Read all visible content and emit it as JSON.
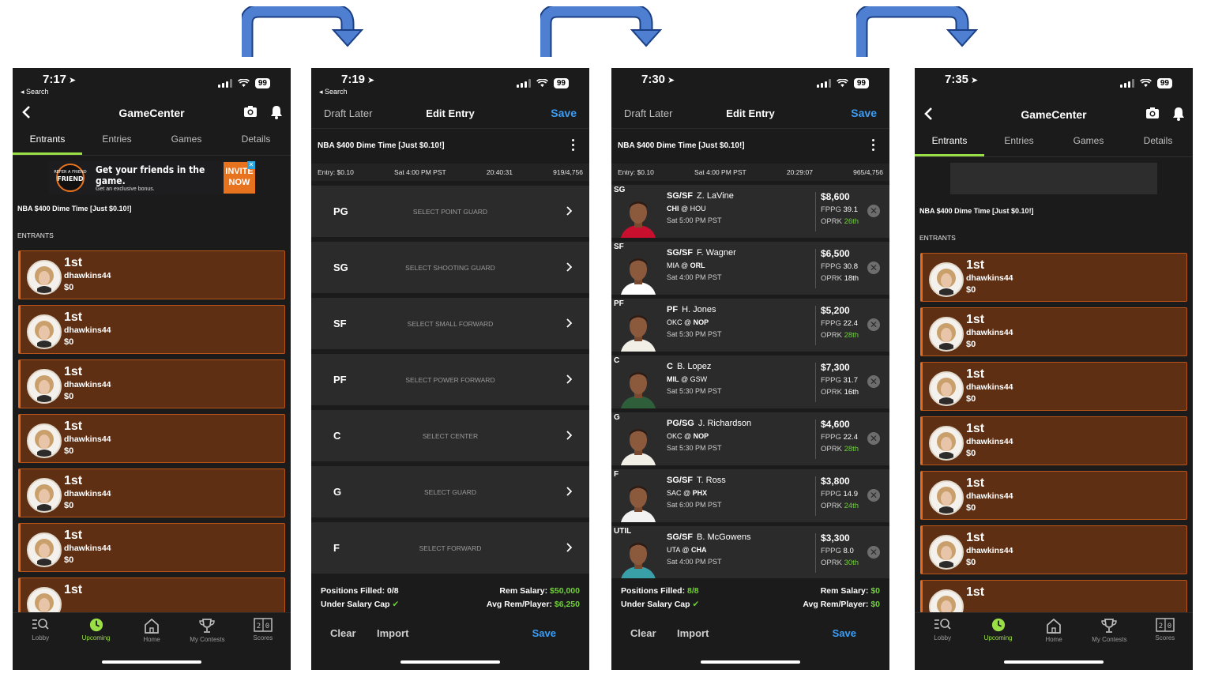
{
  "colors": {
    "arrow": "#2f5aa8",
    "accent_green": "#9adf46",
    "entrant_bg": "#5e2f13",
    "entrant_border": "#e66b1f",
    "save_blue": "#3b9df5",
    "value_green": "#6fcf3a"
  },
  "screen1": {
    "status": {
      "time": "7:17",
      "back": "◂ Search",
      "battery": "99"
    },
    "title": "GameCenter",
    "tabs": [
      "Entrants",
      "Entries",
      "Games",
      "Details"
    ],
    "banner": {
      "text_big": "Get your friends in the game.",
      "text_small": "Get an exclusive bonus.",
      "badge": "REFER A FRIEND",
      "invite_1": "INVITE",
      "invite_2": "NOW"
    },
    "contest": "NBA $400 Dime Time [Just $0.10!]",
    "section_label": "ENTRANTS",
    "entrants": [
      {
        "rank": "1st",
        "user": "dhawkins44",
        "amount": "$0"
      },
      {
        "rank": "1st",
        "user": "dhawkins44",
        "amount": "$0"
      },
      {
        "rank": "1st",
        "user": "dhawkins44",
        "amount": "$0"
      },
      {
        "rank": "1st",
        "user": "dhawkins44",
        "amount": "$0"
      },
      {
        "rank": "1st",
        "user": "dhawkins44",
        "amount": "$0"
      },
      {
        "rank": "1st",
        "user": "dhawkins44",
        "amount": "$0"
      },
      {
        "rank": "1st",
        "user": "",
        "amount": ""
      }
    ],
    "nav": [
      "Lobby",
      "Upcoming",
      "Home",
      "My Contests",
      "Scores"
    ]
  },
  "screen2": {
    "status": {
      "time": "7:19",
      "back": "◂ Search",
      "battery": "99"
    },
    "left": "Draft Later",
    "title": "Edit Entry",
    "save": "Save",
    "contest": "NBA $400 Dime Time [Just $0.10!]",
    "info": {
      "entry": "Entry: $0.10",
      "start": "Sat 4:00 PM PST",
      "countdown": "20:40:31",
      "count": "919/4,756"
    },
    "slots": [
      {
        "pos": "PG",
        "hint": "SELECT POINT GUARD"
      },
      {
        "pos": "SG",
        "hint": "SELECT SHOOTING GUARD"
      },
      {
        "pos": "SF",
        "hint": "SELECT SMALL FORWARD"
      },
      {
        "pos": "PF",
        "hint": "SELECT POWER FORWARD"
      },
      {
        "pos": "C",
        "hint": "SELECT CENTER"
      },
      {
        "pos": "G",
        "hint": "SELECT GUARD"
      },
      {
        "pos": "F",
        "hint": "SELECT FORWARD"
      }
    ],
    "footer": {
      "positions_label": "Positions Filled:",
      "positions_value": "0/8",
      "cap_label": "Under Salary Cap",
      "rem_label": "Rem Salary:",
      "rem_value": "$50,000",
      "avg_label": "Avg Rem/Player:",
      "avg_value": "$6,250",
      "clear": "Clear",
      "import": "Import",
      "save": "Save"
    }
  },
  "screen3": {
    "status": {
      "time": "7:30",
      "battery": "99"
    },
    "left": "Draft Later",
    "title": "Edit Entry",
    "save": "Save",
    "contest": "NBA $400 Dime Time [Just $0.10!]",
    "info": {
      "entry": "Entry: $0.10",
      "start": "Sat 4:00 PM PST",
      "countdown": "20:29:07",
      "count": "965/4,756"
    },
    "players": [
      {
        "slot": "SG",
        "pos": "SG/SF",
        "name": "Z. LaVine",
        "team": "CHI",
        "sep": " @ ",
        "opp": "HOU",
        "bold": "team",
        "time": "Sat 5:00 PM PST",
        "salary": "$8,600",
        "fppg": "39.1",
        "oprk": "26th",
        "oprk_color": "#6fcf3a",
        "jersey": "#c8102e"
      },
      {
        "slot": "SF",
        "pos": "SG/SF",
        "name": "F. Wagner",
        "team": "MIA",
        "sep": " @ ",
        "opp": "ORL",
        "bold": "opp",
        "time": "Sat 4:00 PM PST",
        "salary": "$6,500",
        "fppg": "30.8",
        "oprk": "18th",
        "oprk_color": "#ffffff",
        "jersey": "#ffffff"
      },
      {
        "slot": "PF",
        "pos": "PF",
        "name": "H. Jones",
        "team": "OKC",
        "sep": " @ ",
        "opp": "NOP",
        "bold": "opp",
        "time": "Sat 5:30 PM PST",
        "salary": "$5,200",
        "fppg": "22.4",
        "oprk": "28th",
        "oprk_color": "#6fcf3a",
        "jersey": "#f2efe6"
      },
      {
        "slot": "C",
        "pos": "C",
        "name": "B. Lopez",
        "team": "MIL",
        "sep": " @ ",
        "opp": "GSW",
        "bold": "team",
        "time": "Sat 5:30 PM PST",
        "salary": "$7,300",
        "fppg": "31.7",
        "oprk": "16th",
        "oprk_color": "#ffffff",
        "jersey": "#2f5e3b"
      },
      {
        "slot": "G",
        "pos": "PG/SG",
        "name": "J. Richardson",
        "team": "OKC",
        "sep": " @ ",
        "opp": "NOP",
        "bold": "opp",
        "time": "Sat 5:30 PM PST",
        "salary": "$4,600",
        "fppg": "22.4",
        "oprk": "28th",
        "oprk_color": "#6fcf3a",
        "jersey": "#f2efe6"
      },
      {
        "slot": "F",
        "pos": "SG/SF",
        "name": "T. Ross",
        "team": "SAC",
        "sep": " @ ",
        "opp": "PHX",
        "bold": "opp",
        "time": "Sat 6:00 PM PST",
        "salary": "$3,800",
        "fppg": "14.9",
        "oprk": "24th",
        "oprk_color": "#6fcf3a",
        "jersey": "#f2f2f2"
      },
      {
        "slot": "UTIL",
        "pos": "SG/SF",
        "name": "B. McGowens",
        "team": "UTA",
        "sep": " @ ",
        "opp": "CHA",
        "bold": "opp",
        "time": "Sat 4:00 PM PST",
        "salary": "$3,300",
        "fppg": "8.0",
        "oprk": "30th",
        "oprk_color": "#6fcf3a",
        "jersey": "#3aa0a8"
      }
    ],
    "fppg_label": "FPPG",
    "oprk_label": "OPRK",
    "footer": {
      "positions_label": "Positions Filled:",
      "positions_value": "8/8",
      "cap_label": "Under Salary Cap",
      "rem_label": "Rem Salary:",
      "rem_value": "$0",
      "avg_label": "Avg Rem/Player:",
      "avg_value": "$0",
      "clear": "Clear",
      "import": "Import",
      "save": "Save"
    }
  },
  "screen4": {
    "status": {
      "time": "7:35",
      "battery": "99"
    },
    "title": "GameCenter",
    "tabs": [
      "Entrants",
      "Entries",
      "Games",
      "Details"
    ],
    "contest": "NBA $400 Dime Time [Just $0.10!]",
    "section_label": "ENTRANTS",
    "entrants": [
      {
        "rank": "1st",
        "user": "dhawkins44",
        "amount": "$0"
      },
      {
        "rank": "1st",
        "user": "dhawkins44",
        "amount": "$0"
      },
      {
        "rank": "1st",
        "user": "dhawkins44",
        "amount": "$0"
      },
      {
        "rank": "1st",
        "user": "dhawkins44",
        "amount": "$0"
      },
      {
        "rank": "1st",
        "user": "dhawkins44",
        "amount": "$0"
      },
      {
        "rank": "1st",
        "user": "dhawkins44",
        "amount": "$0"
      },
      {
        "rank": "1st",
        "user": "",
        "amount": ""
      }
    ],
    "nav": [
      "Lobby",
      "Upcoming",
      "Home",
      "My Contests",
      "Scores"
    ]
  }
}
